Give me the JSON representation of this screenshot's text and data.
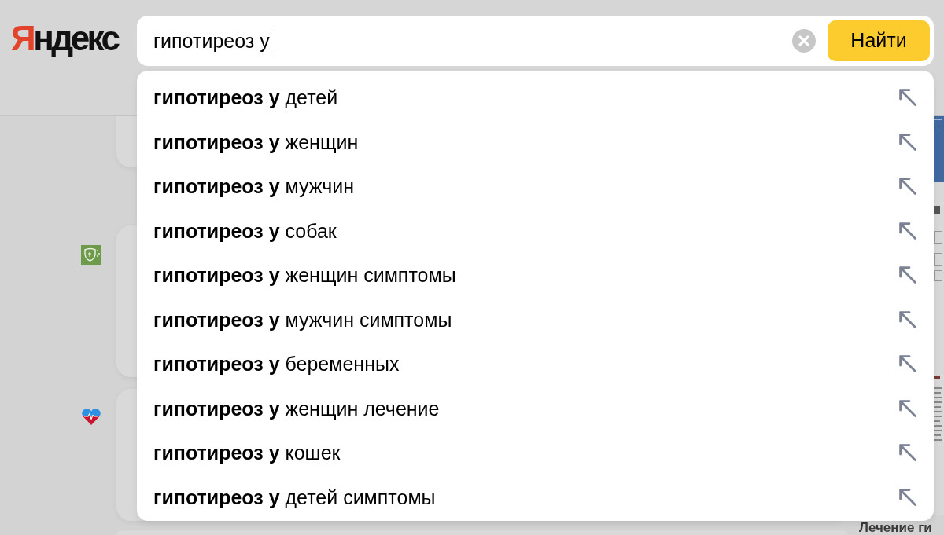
{
  "logo": "Яндекс",
  "search": {
    "value": "гипотиреоз у",
    "button": "Найти"
  },
  "suggestions": [
    "**гипотиреоз у** детей",
    "**гипотиреоз у** женщин",
    "**гипотиреоз у** мужчин",
    "**гипотиреоз у** собак",
    "**гипотиреоз у** женщин симптомы",
    "**гипотиреоз у** мужчин симптомы",
    "**гипотиреоз у** беременных",
    "**гипотиреоз у** женщин лечение",
    "**гипотиреоз у** кошек",
    "**гипотиреоз у** детей симптомы"
  ],
  "background": {
    "heading": "Лечение ги"
  }
}
